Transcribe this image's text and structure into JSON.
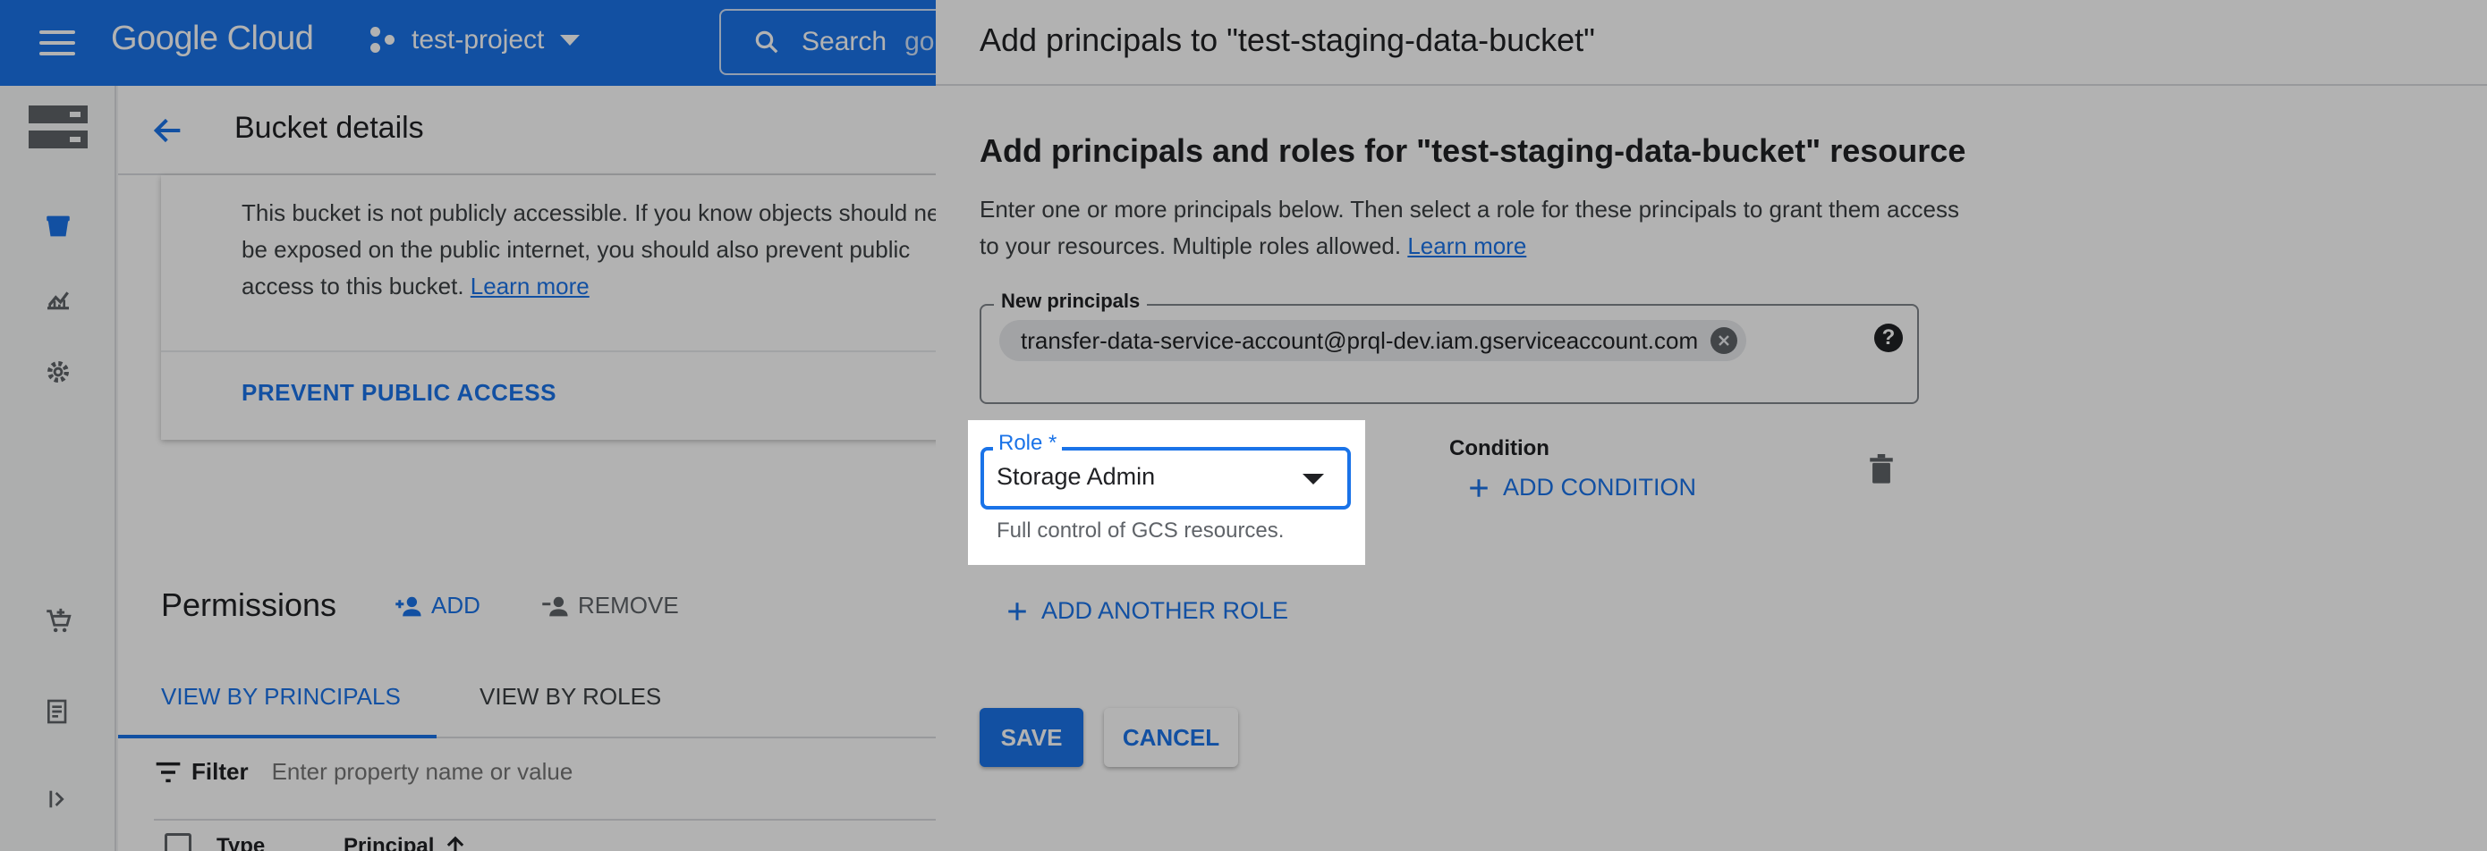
{
  "app": {
    "brand": "Google Cloud",
    "project": "test-project",
    "search_placeholder": "Search",
    "search_overflow": "go"
  },
  "page": {
    "title": "Bucket details"
  },
  "public_access_card": {
    "text": "This bucket is not publicly accessible. If you know objects should never be exposed on the public internet, you should also prevent public access to this bucket.",
    "learn_more": "Learn more",
    "prevent_button": "PREVENT PUBLIC ACCESS"
  },
  "permissions": {
    "title": "Permissions",
    "add_label": "ADD",
    "remove_label": "REMOVE",
    "tabs": [
      {
        "label": "VIEW BY PRINCIPALS",
        "active": true
      },
      {
        "label": "VIEW BY ROLES",
        "active": false
      }
    ],
    "filter_label": "Filter",
    "filter_placeholder": "Enter property name or value",
    "columns": [
      "Type",
      "Principal"
    ]
  },
  "dialog": {
    "title": "Add principals to \"test-staging-data-bucket\"",
    "section_title": "Add principals and roles for \"test-staging-data-bucket\" resource",
    "description": "Enter one or more principals below. Then select a role for these principals to grant them access to your resources. Multiple roles allowed.",
    "learn_more": "Learn more",
    "principals_label": "New principals",
    "principal_chip": "transfer-data-service-account@prql-dev.iam.gserviceaccount.com",
    "role_label": "Role *",
    "role_value": "Storage Admin",
    "role_hint": "Full control of GCS resources.",
    "condition_label": "Condition",
    "add_condition": "ADD CONDITION",
    "add_another_role": "ADD ANOTHER ROLE",
    "save": "SAVE",
    "cancel": "CANCEL"
  },
  "colors": {
    "accent": "#1a73e8",
    "topbar": "#1a73e8",
    "scrim": "rgba(0,0,0,0.30)"
  }
}
